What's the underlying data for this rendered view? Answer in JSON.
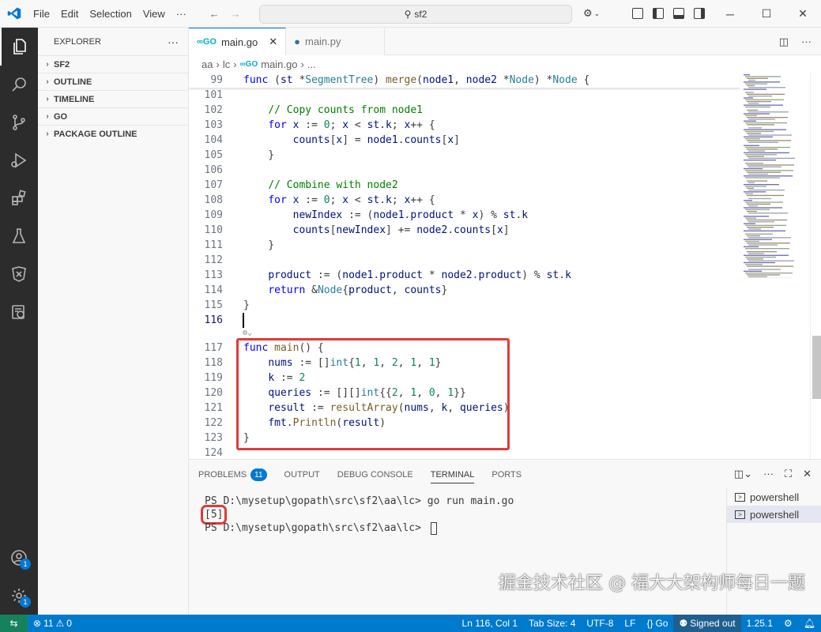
{
  "menu": [
    "File",
    "Edit",
    "Selection",
    "View",
    "···"
  ],
  "search": {
    "text": "sf2"
  },
  "sidebar": {
    "title": "EXPLORER",
    "more": "···",
    "sections": [
      "SF2",
      "OUTLINE",
      "TIMELINE",
      "GO",
      "PACKAGE OUTLINE"
    ]
  },
  "activity_badges": {
    "accounts": "1",
    "manage": "1"
  },
  "tabs": [
    {
      "label": "main.go",
      "icon": "go-icon",
      "active": true
    },
    {
      "label": "main.py",
      "icon": "python-icon",
      "active": false
    }
  ],
  "breadcrumbs": [
    "aa",
    "lc",
    "main.go",
    "..."
  ],
  "sticky": {
    "num": "99",
    "code": "func (st *SegmentTree) merge(node1, node2 *Node) *Node {"
  },
  "code_lines": [
    {
      "num": "101",
      "code": ""
    },
    {
      "num": "102",
      "code": "    // Copy counts from node1"
    },
    {
      "num": "103",
      "code": "    for x := 0; x < st.k; x++ {"
    },
    {
      "num": "104",
      "code": "        counts[x] = node1.counts[x]"
    },
    {
      "num": "105",
      "code": "    }"
    },
    {
      "num": "106",
      "code": ""
    },
    {
      "num": "107",
      "code": "    // Combine with node2"
    },
    {
      "num": "108",
      "code": "    for x := 0; x < st.k; x++ {"
    },
    {
      "num": "109",
      "code": "        newIndex := (node1.product * x) % st.k"
    },
    {
      "num": "110",
      "code": "        counts[newIndex] += node2.counts[x]"
    },
    {
      "num": "111",
      "code": "    }"
    },
    {
      "num": "112",
      "code": ""
    },
    {
      "num": "113",
      "code": "    product := (node1.product * node2.product) % st.k"
    },
    {
      "num": "114",
      "code": "    return &Node{product, counts}"
    },
    {
      "num": "115",
      "code": "}"
    },
    {
      "num": "116",
      "code": ""
    },
    {
      "num": "117",
      "code": "func main() {"
    },
    {
      "num": "118",
      "code": "    nums := []int{1, 1, 2, 1, 1}"
    },
    {
      "num": "119",
      "code": "    k := 2"
    },
    {
      "num": "120",
      "code": "    queries := [][]int{{2, 1, 0, 1}}"
    },
    {
      "num": "121",
      "code": "    result := resultArray(nums, k, queries)"
    },
    {
      "num": "122",
      "code": "    fmt.Println(result)"
    },
    {
      "num": "123",
      "code": "}"
    },
    {
      "num": "124",
      "code": ""
    }
  ],
  "panel": {
    "tabs": [
      "PROBLEMS",
      "OUTPUT",
      "DEBUG CONSOLE",
      "TERMINAL",
      "PORTS"
    ],
    "problems_count": "11",
    "active_tab": "TERMINAL"
  },
  "terminal": {
    "line1": "PS D:\\mysetup\\gopath\\src\\sf2\\aa\\lc> go run main.go",
    "line2": "[5]",
    "line3": "PS D:\\mysetup\\gopath\\src\\sf2\\aa\\lc> ",
    "instances": [
      "powershell",
      "powershell"
    ]
  },
  "watermark": "掘金技术社区 @ 福大大架构师每日一题",
  "status": {
    "errors": "11",
    "warnings": "0",
    "position": "Ln 116, Col 1",
    "tab_size": "Tab Size: 4",
    "encoding": "UTF-8",
    "eol": "LF",
    "language": "Go",
    "signed": "Signed out",
    "version": "1.25.1"
  },
  "colors": {
    "accent": "#007acc",
    "highlight": "#e03a3a",
    "activity_bg": "#2c2c2c"
  }
}
